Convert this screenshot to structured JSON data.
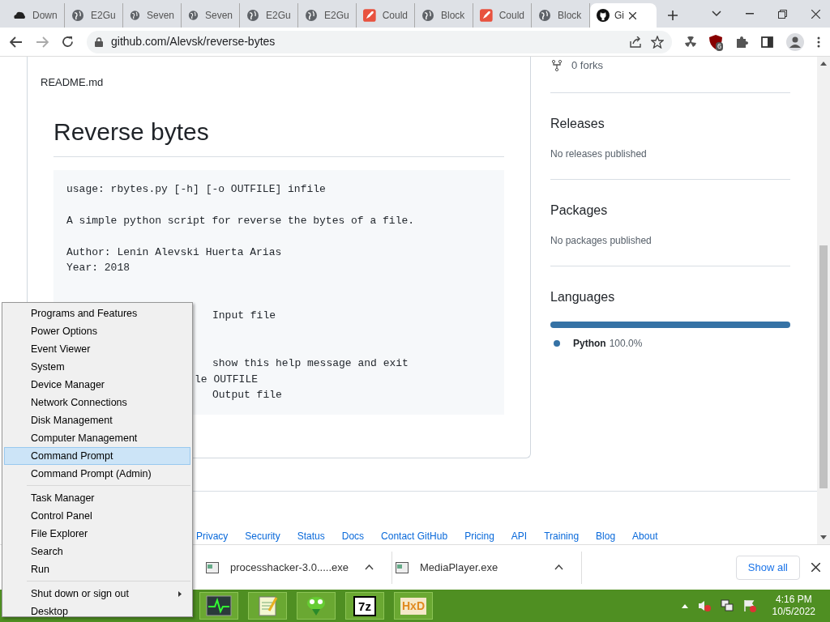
{
  "tabs": [
    {
      "title": "Down",
      "kind": "cloud",
      "selected": false
    },
    {
      "title": "E2Gu",
      "kind": "globe",
      "selected": false
    },
    {
      "title": "Seven",
      "kind": "globe",
      "selected": false
    },
    {
      "title": "Seven",
      "kind": "globe",
      "selected": false
    },
    {
      "title": "E2Gu",
      "kind": "globe",
      "selected": false
    },
    {
      "title": "E2Gu",
      "kind": "globe",
      "selected": false
    },
    {
      "title": "Could",
      "kind": "rocket",
      "selected": false
    },
    {
      "title": "Block",
      "kind": "globe",
      "selected": false
    },
    {
      "title": "Could",
      "kind": "rocket",
      "selected": false
    },
    {
      "title": "Block",
      "kind": "globe",
      "selected": false
    },
    {
      "title": "Gi",
      "kind": "github",
      "selected": true
    }
  ],
  "address": {
    "url": "github.com/Alevsk/reverse-bytes"
  },
  "extensions": {
    "badge": "6"
  },
  "readme": {
    "file": "README.md",
    "heading": "Reverse bytes",
    "code_lines": [
      {
        "kind": "full",
        "text": "usage: rbytes.py [-h] [-o OUTFILE] infile"
      },
      {
        "kind": "blank"
      },
      {
        "kind": "full",
        "text": "A simple python script for reverse the bytes of a file."
      },
      {
        "kind": "blank"
      },
      {
        "kind": "full",
        "text": "Author: Lenin Alevski Huerta Arias"
      },
      {
        "kind": "full",
        "text": "Year: 2018"
      },
      {
        "kind": "blank"
      },
      {
        "kind": "blank"
      },
      {
        "kind": "help",
        "text": "Input file"
      },
      {
        "kind": "blank"
      },
      {
        "kind": "blank"
      },
      {
        "kind": "help",
        "text": "show this help message and exit"
      },
      {
        "kind": "tail",
        "text": "le OUTFILE"
      },
      {
        "kind": "help",
        "text": "Output file"
      }
    ]
  },
  "sidebar": {
    "forks": "0 forks",
    "sections": [
      {
        "title": "Releases",
        "note": "No releases published"
      },
      {
        "title": "Packages",
        "note": "No packages published"
      }
    ],
    "languages": {
      "title": "Languages",
      "items": [
        {
          "name": "Python",
          "share": "100.0%",
          "level": 1.0,
          "color": "#3572a5"
        }
      ]
    }
  },
  "footer_links": [
    "Privacy",
    "Security",
    "Status",
    "Docs",
    "Contact GitHub",
    "Pricing",
    "API",
    "Training",
    "Blog",
    "About"
  ],
  "downloads": {
    "items": [
      {
        "name": "processhacker-3.0.....exe"
      },
      {
        "name": "MediaPlayer.exe"
      }
    ],
    "show_all": "Show all"
  },
  "context_menu": {
    "groups": [
      [
        {
          "label": "Programs and Features",
          "selected": false
        },
        {
          "label": "Power Options",
          "selected": false
        },
        {
          "label": "Event Viewer",
          "selected": false
        },
        {
          "label": "System",
          "selected": false
        },
        {
          "label": "Device Manager",
          "selected": false
        },
        {
          "label": "Network Connections",
          "selected": false
        },
        {
          "label": "Disk Management",
          "selected": false
        },
        {
          "label": "Computer Management",
          "selected": false
        },
        {
          "label": "Command Prompt",
          "selected": true
        },
        {
          "label": "Command Prompt (Admin)",
          "selected": false
        }
      ],
      [
        {
          "label": "Task Manager",
          "selected": false
        },
        {
          "label": "Control Panel",
          "selected": false
        },
        {
          "label": "File Explorer",
          "selected": false
        },
        {
          "label": "Search",
          "selected": false
        },
        {
          "label": "Run",
          "selected": false
        }
      ],
      [
        {
          "label": "Shut down or sign out",
          "selected": false,
          "submenu": true
        },
        {
          "label": "Desktop",
          "selected": false
        }
      ]
    ]
  },
  "taskbar": {
    "apps": [
      {
        "kind": "monitor"
      },
      {
        "kind": "notepad"
      },
      {
        "kind": "chameleon"
      },
      {
        "kind": "sevenzip",
        "text": "7z"
      },
      {
        "kind": "hex",
        "text": "HxD"
      }
    ],
    "clock": {
      "time": "4:16 PM",
      "date": "10/5/2022"
    }
  }
}
